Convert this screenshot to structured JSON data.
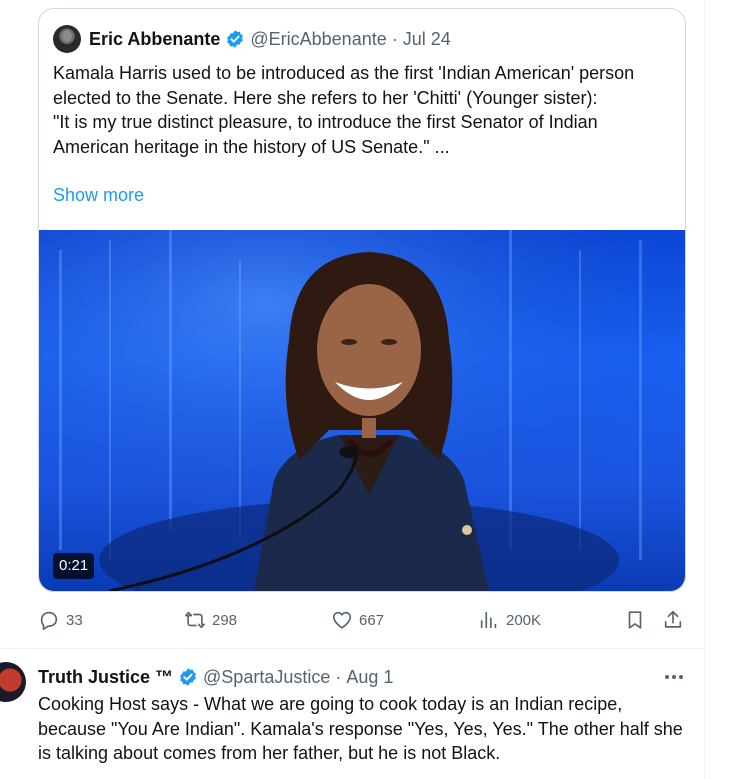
{
  "quoted_tweet": {
    "author_name": "Eric Abbenante",
    "handle": "@EricAbbenante",
    "separator": "·",
    "date": "Jul 24",
    "text_lines": [
      "Kamala Harris used to be introduced as the first 'Indian American' person elected to the Senate. Here she refers to her 'Chitti' (Younger sister):",
      "\"It is my true distinct pleasure, to introduce the first Senator of Indian American heritage in the history of US Senate.\" ..."
    ],
    "show_more": "Show more",
    "video_duration": "0:21"
  },
  "actions": {
    "replies": "33",
    "reposts": "298",
    "likes": "667",
    "views": "200K"
  },
  "reply_tweet": {
    "author_name": "Truth Justice ™",
    "handle": "@SpartaJustice",
    "separator": "·",
    "date": "Aug 1",
    "text": "Cooking Host says - What we are going to cook today is an Indian recipe, because \"You Are Indian\". Kamala's response \"Yes, Yes, Yes.\"  The other half she is talking about comes from her father, but he is not Black."
  },
  "icons": {
    "verified": "verified-badge-icon",
    "reply": "reply-icon",
    "repost": "repost-icon",
    "like": "like-icon",
    "views": "views-icon",
    "bookmark": "bookmark-icon",
    "share": "share-icon",
    "more": "more-icon"
  },
  "colors": {
    "accent": "#1d9bf0",
    "text_primary": "#0f1419",
    "text_secondary": "#536471",
    "border": "#cfd9de"
  }
}
